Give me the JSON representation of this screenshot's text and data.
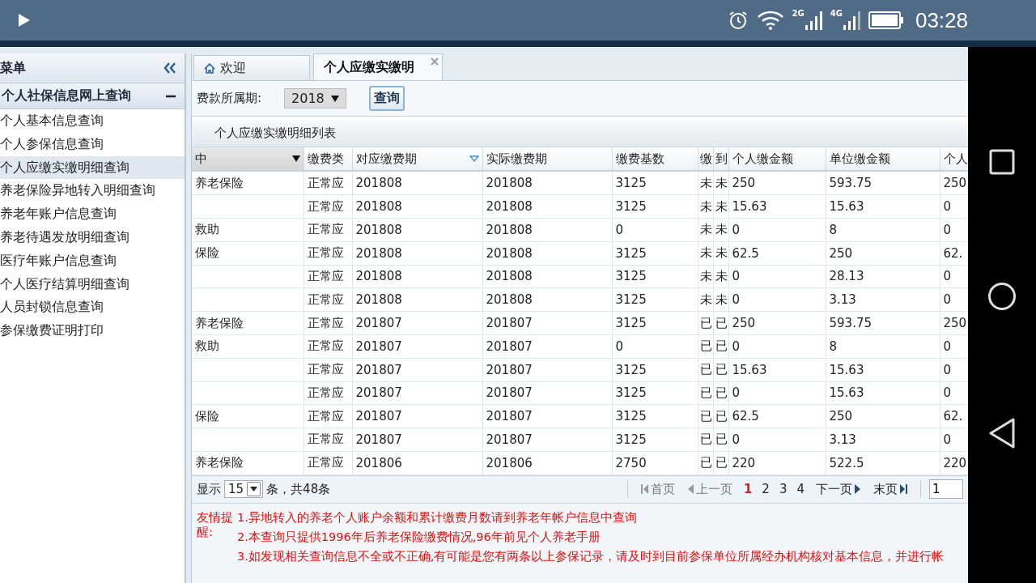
{
  "status_bar": {
    "network_1": "2G",
    "network_2": "4G",
    "time": "03:28"
  },
  "sidebar": {
    "title": "菜单",
    "group": "个人社保信息网上查询",
    "expanded": true,
    "items": [
      {
        "label": "个人基本信息查询",
        "selected": false
      },
      {
        "label": "个人参保信息查询",
        "selected": false
      },
      {
        "label": "个人应缴实缴明细查询",
        "selected": true
      },
      {
        "label": "养老保险异地转入明细查询",
        "selected": false
      },
      {
        "label": "养老年账户信息查询",
        "selected": false
      },
      {
        "label": "养老待遇发放明细查询",
        "selected": false
      },
      {
        "label": "医疗年账户信息查询",
        "selected": false
      },
      {
        "label": "个人医疗结算明细查询",
        "selected": false
      },
      {
        "label": "人员封锁信息查询",
        "selected": false
      },
      {
        "label": "参保缴费证明打印",
        "selected": false
      }
    ]
  },
  "tabs": [
    {
      "label": "欢迎",
      "kind": "home",
      "selected": false
    },
    {
      "label": "个人应缴实缴明",
      "kind": "closable",
      "selected": true
    }
  ],
  "filter": {
    "label": "费款所属期:",
    "year": "2018",
    "button": "查询"
  },
  "table": {
    "title": "个人应缴实缴明细列表",
    "columns": [
      "中",
      "缴费类",
      "对应缴费期",
      "实际缴费期",
      "缴费基数",
      "缴",
      "到",
      "个人缴金额",
      "单位缴金额",
      "个人"
    ],
    "rows": [
      [
        "养老保险",
        "正常应",
        "201808",
        "201808",
        "3125",
        "未",
        "未",
        "250",
        "593.75",
        "250"
      ],
      [
        "",
        "正常应",
        "201808",
        "201808",
        "3125",
        "未",
        "未",
        "15.63",
        "15.63",
        "0"
      ],
      [
        "救助",
        "正常应",
        "201808",
        "201808",
        "0",
        "未",
        "未",
        "0",
        "8",
        "0"
      ],
      [
        "保险",
        "正常应",
        "201808",
        "201808",
        "3125",
        "未",
        "未",
        "62.5",
        "250",
        "62."
      ],
      [
        "",
        "正常应",
        "201808",
        "201808",
        "3125",
        "未",
        "未",
        "0",
        "28.13",
        "0"
      ],
      [
        "",
        "正常应",
        "201808",
        "201808",
        "3125",
        "未",
        "未",
        "0",
        "3.13",
        "0"
      ],
      [
        "养老保险",
        "正常应",
        "201807",
        "201807",
        "3125",
        "已",
        "已",
        "250",
        "593.75",
        "250"
      ],
      [
        "救助",
        "正常应",
        "201807",
        "201807",
        "0",
        "已",
        "已",
        "0",
        "8",
        "0"
      ],
      [
        "",
        "正常应",
        "201807",
        "201807",
        "3125",
        "已",
        "已",
        "15.63",
        "15.63",
        "0"
      ],
      [
        "",
        "正常应",
        "201807",
        "201807",
        "3125",
        "已",
        "已",
        "0",
        "15.63",
        "0"
      ],
      [
        "保险",
        "正常应",
        "201807",
        "201807",
        "3125",
        "已",
        "已",
        "62.5",
        "250",
        "62."
      ],
      [
        "",
        "正常应",
        "201807",
        "201807",
        "3125",
        "已",
        "已",
        "0",
        "3.13",
        "0"
      ],
      [
        "养老保险",
        "正常应",
        "201806",
        "201806",
        "2750",
        "已",
        "已",
        "220",
        "522.5",
        "220"
      ]
    ]
  },
  "pager": {
    "show_label": "显示",
    "page_size": "15",
    "total": "条，共48条",
    "first": "首页",
    "prev": "上一页",
    "pages": [
      {
        "label": "1",
        "selected": true
      },
      {
        "label": "2",
        "selected": false
      },
      {
        "label": "3",
        "selected": false
      },
      {
        "label": "4",
        "selected": false
      }
    ],
    "next": "下一页",
    "last": "末页",
    "page_input": "1"
  },
  "notice": {
    "label": "友情提醒:",
    "lines": [
      "1.异地转入的养老个人账户余额和累计缴费月数请到养老年帐户信息中查询",
      "2.本查询只提供1996年后养老保险缴费情况,96年前见个人养老手册",
      "3.如发现相关查询信息不全或不正确,有可能是您有两条以上参保记录，请及时到目前参保单位所属经办机构核对基本信息，并进行帐"
    ]
  }
}
